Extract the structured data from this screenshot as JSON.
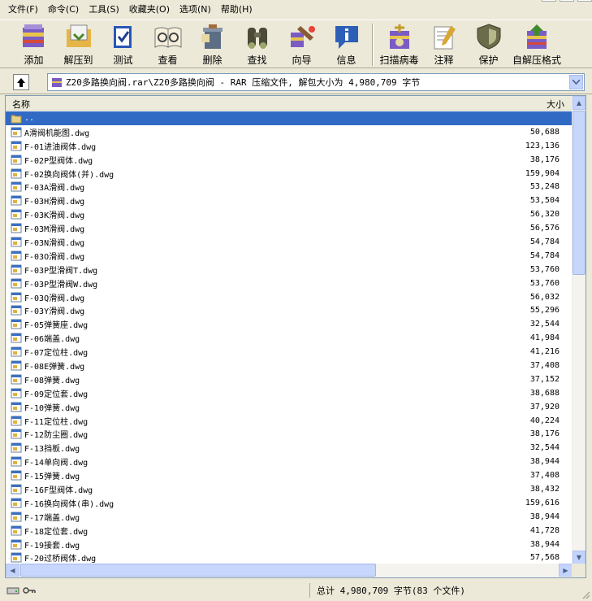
{
  "menu": [
    "文件(F)",
    "命令(C)",
    "工具(S)",
    "收藏夹(O)",
    "选项(N)",
    "帮助(H)"
  ],
  "toolbar": [
    {
      "label": "添加",
      "icon": "add-icon"
    },
    {
      "label": "解压到",
      "icon": "extract-to-icon"
    },
    {
      "label": "测试",
      "icon": "test-icon"
    },
    {
      "label": "查看",
      "icon": "view-icon"
    },
    {
      "label": "删除",
      "icon": "delete-icon"
    },
    {
      "label": "查找",
      "icon": "find-icon"
    },
    {
      "label": "向导",
      "icon": "wizard-icon"
    },
    {
      "label": "信息",
      "icon": "info-icon"
    },
    {
      "label": "扫描病毒",
      "icon": "virus-scan-icon"
    },
    {
      "label": "注释",
      "icon": "comment-icon"
    },
    {
      "label": "保护",
      "icon": "protect-icon"
    },
    {
      "label": "自解压格式",
      "icon": "sfx-icon"
    }
  ],
  "address": {
    "path": "Z20多路换向阀.rar\\Z20多路换向阀 - RAR 压缩文件, 解包大小为 4,980,709 字节"
  },
  "columns": {
    "name": "名称",
    "size": "大小"
  },
  "files": [
    {
      "name": "..",
      "size": "",
      "type": "folder"
    },
    {
      "name": "A滑阀机能图.dwg",
      "size": "50,688"
    },
    {
      "name": "F-01进油阀体.dwg",
      "size": "123,136"
    },
    {
      "name": "F-02P型阀体.dwg",
      "size": "38,176"
    },
    {
      "name": "F-02换向阀体(并).dwg",
      "size": "159,904"
    },
    {
      "name": "F-03A滑阀.dwg",
      "size": "53,248"
    },
    {
      "name": "F-03H滑阀.dwg",
      "size": "53,504"
    },
    {
      "name": "F-03K滑阀.dwg",
      "size": "56,320"
    },
    {
      "name": "F-03M滑阀.dwg",
      "size": "56,576"
    },
    {
      "name": "F-03N滑阀.dwg",
      "size": "54,784"
    },
    {
      "name": "F-03O滑阀.dwg",
      "size": "54,784"
    },
    {
      "name": "F-03P型滑阀T.dwg",
      "size": "53,760"
    },
    {
      "name": "F-03P型滑阀W.dwg",
      "size": "53,760"
    },
    {
      "name": "F-03Q滑阀.dwg",
      "size": "56,032"
    },
    {
      "name": "F-03Y滑阀.dwg",
      "size": "55,296"
    },
    {
      "name": "F-05弹簧座.dwg",
      "size": "32,544"
    },
    {
      "name": "F-06端盖.dwg",
      "size": "41,984"
    },
    {
      "name": "F-07定位柱.dwg",
      "size": "41,216"
    },
    {
      "name": "F-08E弹簧.dwg",
      "size": "37,408"
    },
    {
      "name": "F-08弹簧.dwg",
      "size": "37,152"
    },
    {
      "name": "F-09定位套.dwg",
      "size": "38,688"
    },
    {
      "name": "F-10弹簧.dwg",
      "size": "37,920"
    },
    {
      "name": "F-11定位柱.dwg",
      "size": "40,224"
    },
    {
      "name": "F-12防尘圈.dwg",
      "size": "38,176"
    },
    {
      "name": "F-13挡板.dwg",
      "size": "32,544"
    },
    {
      "name": "F-14单向阀.dwg",
      "size": "38,944"
    },
    {
      "name": "F-15弹簧.dwg",
      "size": "37,408"
    },
    {
      "name": "F-16F型阀体.dwg",
      "size": "38,432"
    },
    {
      "name": "F-16换向阀体(串).dwg",
      "size": "159,616"
    },
    {
      "name": "F-17端盖.dwg",
      "size": "38,944"
    },
    {
      "name": "F-18定位套.dwg",
      "size": "41,728"
    },
    {
      "name": "F-19接套.dwg",
      "size": "38,944"
    },
    {
      "name": "F-20过桥阀体.dwg",
      "size": "57,568"
    }
  ],
  "status": {
    "summary": "总计 4,980,709 字节(83 个文件)"
  },
  "colors": {
    "selection": "#316ac5",
    "chrome": "#ece9d8",
    "scroll": "#c3d3fd"
  }
}
